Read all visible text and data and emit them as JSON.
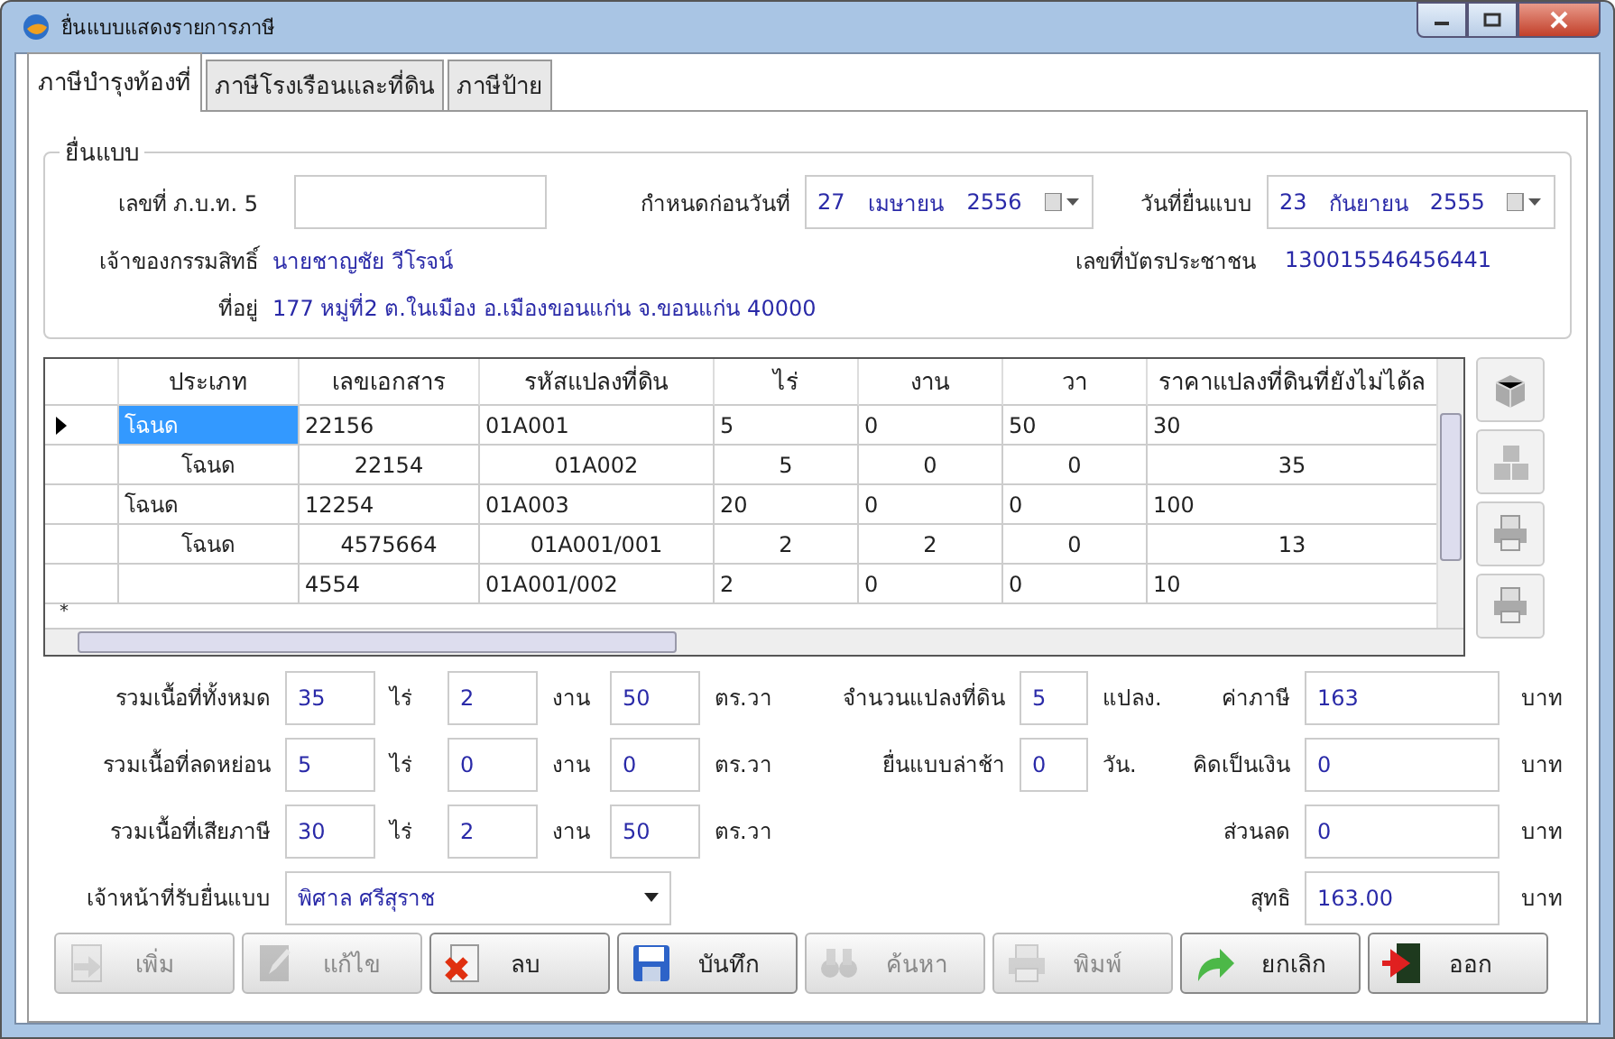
{
  "window": {
    "title": "ยื่นแบบแสดงรายการภาษี"
  },
  "tabs": [
    {
      "label": "ภาษีบำรุงท้องที่",
      "selected": true
    },
    {
      "label": "ภาษีโรงเรือนและที่ดิน",
      "selected": false
    },
    {
      "label": "ภาษีป้าย",
      "selected": false
    }
  ],
  "filing": {
    "legend": "ยื่นแบบ",
    "form_no": {
      "label": "เลขที่ ภ.บ.ท. 5"
    },
    "due_date": {
      "label": "กำหนดก่อนวันที่",
      "day": "27",
      "month": "เมษายน",
      "year": "2556"
    },
    "filed_date": {
      "label": "วันที่ยื่นแบบ",
      "day": "23",
      "month": "กันยายน",
      "year": "2555"
    },
    "owner": {
      "label": "เจ้าของกรรมสิทธิ์",
      "value": "นายชาญชัย  วีโรจน์"
    },
    "id_card": {
      "label": "เลขที่บัตรประชาชน",
      "value": "130015546456441"
    },
    "address": {
      "label": "ที่อยู่",
      "value": "177 หมู่ที่2  ต.ในเมือง อ.เมืองขอนแก่น จ.ขอนแก่น 40000"
    }
  },
  "table": {
    "columns": [
      "ประเภท",
      "เลขเอกสาร",
      "รหัสแปลงที่ดิน",
      "ไร่",
      "งาน",
      "วา",
      "ราคาแปลงที่ดินที่ยังไม่ได้ล"
    ],
    "rows": [
      {
        "kind": "left",
        "selected": true,
        "cells": [
          "โฉนด",
          "22156",
          "01A001",
          "5",
          "0",
          "50",
          "30"
        ]
      },
      {
        "kind": "centered",
        "selected": false,
        "cells": [
          "โฉนด",
          "22154",
          "01A002",
          "5",
          "0",
          "0",
          "35"
        ]
      },
      {
        "kind": "left",
        "selected": false,
        "cells": [
          "โฉนด",
          "12254",
          "01A003",
          "20",
          "0",
          "0",
          "100"
        ]
      },
      {
        "kind": "centered",
        "selected": false,
        "cells": [
          "โฉนด",
          "4575664",
          "01A001/001",
          "2",
          "2",
          "0",
          "13"
        ]
      },
      {
        "kind": "left",
        "selected": false,
        "cells": [
          null,
          "4554",
          "01A001/002",
          "2",
          "0",
          "0",
          "10"
        ]
      }
    ],
    "new_row_marker": "*"
  },
  "side_tools": [
    {
      "kind": "box"
    },
    {
      "kind": "boxes"
    },
    {
      "kind": "printer"
    },
    {
      "kind": "printer"
    }
  ],
  "areas": [
    {
      "label": "รวมเนื้อที่ทั้งหมด",
      "fields": [
        {
          "value": "35",
          "unit": "ไร่"
        },
        {
          "value": "2",
          "unit": "งาน"
        },
        {
          "value": "50",
          "unit": "ตร.วา"
        }
      ]
    },
    {
      "label": "รวมเนื้อที่ลดหย่อน",
      "fields": [
        {
          "value": "5",
          "unit": "ไร่"
        },
        {
          "value": "0",
          "unit": "งาน"
        },
        {
          "value": "0",
          "unit": "ตร.วา"
        }
      ]
    },
    {
      "label": "รวมเนื้อที่เสียภาษี",
      "fields": [
        {
          "value": "30",
          "unit": "ไร่"
        },
        {
          "value": "2",
          "unit": "งาน"
        },
        {
          "value": "50",
          "unit": "ตร.วา"
        }
      ]
    }
  ],
  "officer": {
    "label": "เจ้าหน้าที่รับยื่นแบบ",
    "value": "พิศาล ศรีสุราช"
  },
  "counts": [
    {
      "label": "จำนวนแปลงที่ดิน",
      "value": "5",
      "unit": "แปลง."
    },
    {
      "label": "ยื่นแบบล่าช้า",
      "value": "0",
      "unit": "วัน."
    }
  ],
  "amounts": [
    {
      "label": "ค่าภาษี",
      "value": "163",
      "unit": "บาท"
    },
    {
      "label": "คิดเป็นเงิน",
      "value": "0",
      "unit": "บาท"
    },
    {
      "label": "ส่วนลด",
      "value": "0",
      "unit": "บาท"
    },
    {
      "label": "สุทธิ",
      "value": "163.00",
      "unit": "บาท"
    }
  ],
  "buttons": [
    {
      "label": "เพิ่ม",
      "kind": "add",
      "disabled": true
    },
    {
      "label": "แก้ไข",
      "kind": "edit",
      "disabled": true
    },
    {
      "label": "ลบ",
      "kind": "delete",
      "disabled": false
    },
    {
      "label": "บันทึก",
      "kind": "save",
      "disabled": false
    },
    {
      "label": "ค้นหา",
      "kind": "search",
      "disabled": true
    },
    {
      "label": "พิมพ์",
      "kind": "print",
      "disabled": true
    },
    {
      "label": "ยกเลิก",
      "kind": "undo",
      "disabled": false
    },
    {
      "label": "ออก",
      "kind": "exit",
      "disabled": false
    }
  ]
}
